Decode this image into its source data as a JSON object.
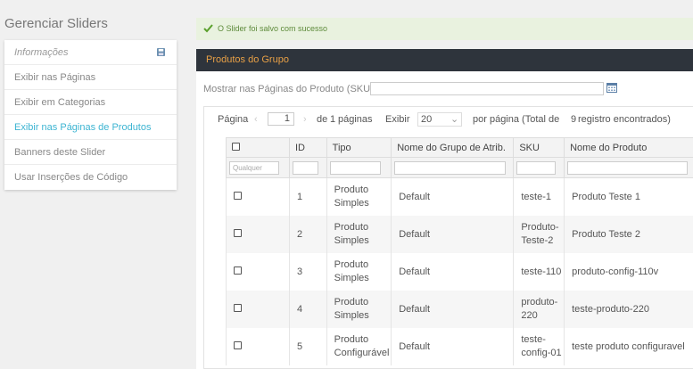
{
  "sidebar": {
    "title": "Gerenciar Sliders",
    "items": [
      {
        "label": "Informações"
      },
      {
        "label": "Exibir nas Páginas"
      },
      {
        "label": "Exibir em Categorias"
      },
      {
        "label": "Exibir nas Páginas de Produtos"
      },
      {
        "label": "Banners deste Slider"
      },
      {
        "label": "Usar Inserções de Código"
      }
    ]
  },
  "message": {
    "text": "O Slider foi salvo com sucesso"
  },
  "panel": {
    "title": "Produtos do Grupo",
    "sku_label": "Mostrar nas Páginas do Produto (SKU)"
  },
  "pager": {
    "page_label": "Página",
    "page_value": "1",
    "of_label": "de",
    "total_pages": "1",
    "pages_label": "páginas",
    "show_label": "Exibir",
    "per_page": "20",
    "per_page_label": "por página (Total de",
    "total_records": "9",
    "records_label": "registro encontrados)"
  },
  "grid": {
    "columns": [
      "ID",
      "Tipo",
      "Nome do Grupo de Atrib.",
      "SKU",
      "Nome do Produto"
    ],
    "filter_any": "Qualquer",
    "rows": [
      {
        "id": "1",
        "tipo": [
          "Produto",
          "Simples"
        ],
        "grupo": "Default",
        "sku": [
          "teste-1"
        ],
        "nome": "Produto Teste 1"
      },
      {
        "id": "2",
        "tipo": [
          "Produto",
          "Simples"
        ],
        "grupo": "Default",
        "sku": [
          "Produto-",
          "Teste-2"
        ],
        "nome": "Produto Teste 2"
      },
      {
        "id": "3",
        "tipo": [
          "Produto",
          "Simples"
        ],
        "grupo": "Default",
        "sku": [
          "teste-110"
        ],
        "nome": "produto-config-110v"
      },
      {
        "id": "4",
        "tipo": [
          "Produto",
          "Simples"
        ],
        "grupo": "Default",
        "sku": [
          "produto-",
          "220"
        ],
        "nome": "teste-produto-220"
      },
      {
        "id": "5",
        "tipo": [
          "Produto",
          "Configurável"
        ],
        "grupo": "Default",
        "sku": [
          "teste-",
          "config-01"
        ],
        "nome": "teste produto configuravel"
      }
    ]
  }
}
